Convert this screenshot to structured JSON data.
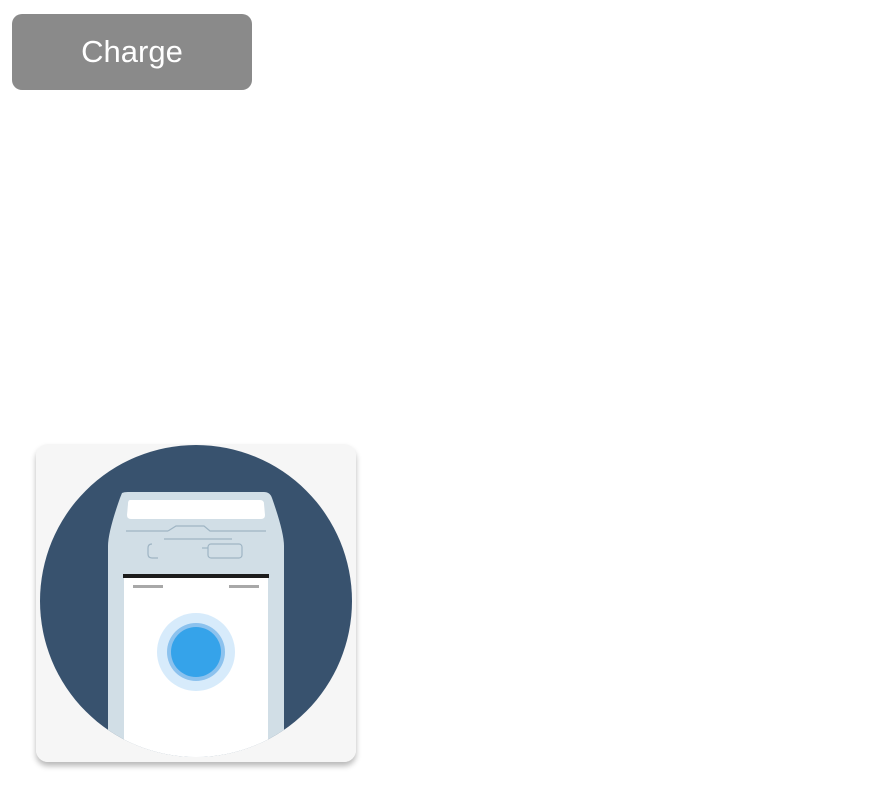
{
  "charge_button": {
    "label": "Charge",
    "background": "#8a8a8a",
    "text_color": "#ffffff"
  },
  "terminal_illustration": {
    "icon": "card-terminal-icon",
    "colors": {
      "card_background": "#f6f6f6",
      "circle": "#38526e",
      "terminal_body": "#d1dee6",
      "terminal_slot": "#ffffff",
      "screen": "#ffffff",
      "screen_bar": "#1c1c1c",
      "screen_dash": "#a8a8a8",
      "contactless_halo": "#d7ebfb",
      "contactless_ring": "#8cc2ee",
      "contactless_dot": "#35a3ea"
    }
  }
}
